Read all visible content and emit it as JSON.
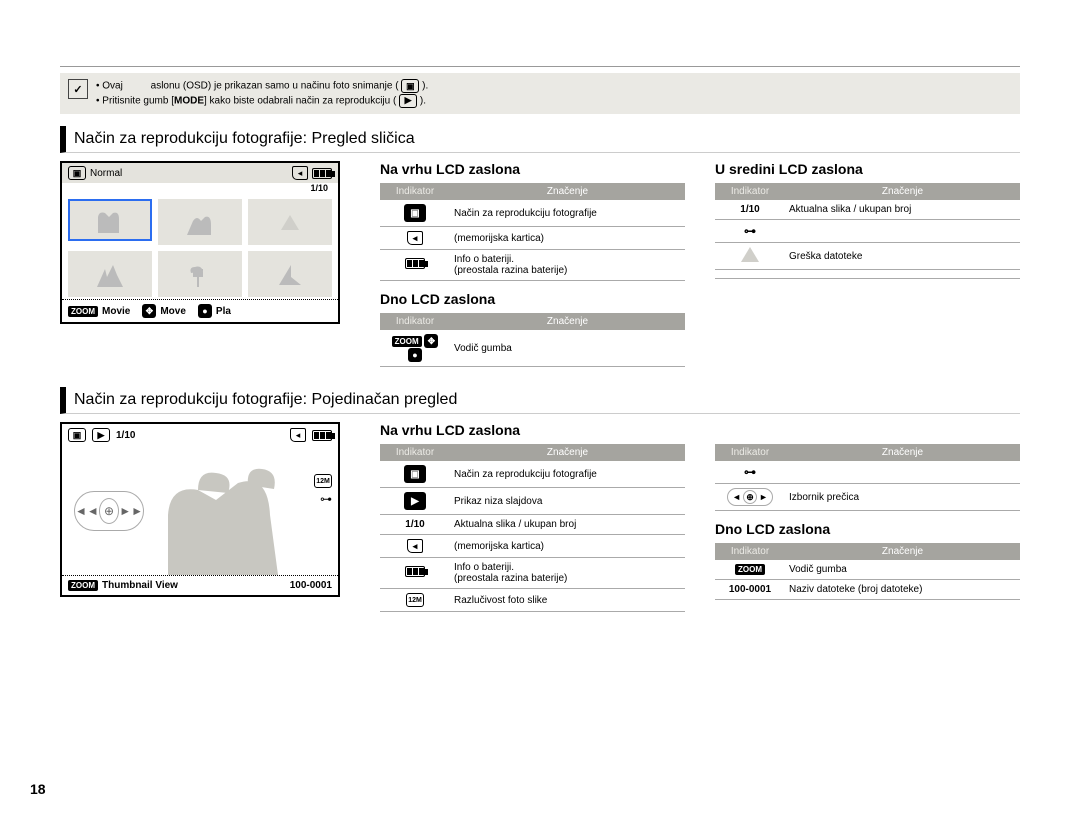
{
  "page_title": "",
  "page_number": "18",
  "note": {
    "icon": "✓",
    "line1_a": "Ovaj",
    "line1_b": "aslonu (OSD) je prikazan samo u načinu foto snimanje (",
    "line1_c": ").",
    "line2_a": "Pritisnite gumb [",
    "line2_mode": "MODE",
    "line2_b": "] kako biste odabrali način za reprodukciju (",
    "line2_c": ")."
  },
  "sections": {
    "thumb": {
      "heading": "Način za reprodukciju fotografije: Pregled sličica",
      "lcd": {
        "normal_label": "Normal",
        "count": "1/10",
        "footer": {
          "zoom": "ZOOM",
          "movie": "Movie",
          "move": "Move",
          "play": "Pla"
        }
      },
      "top": {
        "title": "Na vrhu LCD zaslona",
        "th_indicator": "Indikator",
        "th_meaning": "Značenje",
        "rows": [
          {
            "ind_kind": "play-photo",
            "text": "Način za reprodukciju fotografije"
          },
          {
            "ind_kind": "card",
            "text": "(memorijska kartica)"
          },
          {
            "ind_kind": "battery",
            "text": "Info o bateriji.\n(preostala razina baterije)"
          }
        ]
      },
      "bottom": {
        "title": "Dno LCD zaslona",
        "th_indicator": "Indikator",
        "th_meaning": "Značenje",
        "rows": [
          {
            "ind_kind": "zoom-guide",
            "text": "Vodič gumba"
          }
        ]
      },
      "middle": {
        "title": "U sredini LCD zaslona",
        "th_indicator": "Indikator",
        "th_meaning": "Značenje",
        "rows": [
          {
            "ind_text": "1/10",
            "text": "Aktualna slika / ukupan broj"
          },
          {
            "ind_kind": "key",
            "text": ""
          },
          {
            "ind_kind": "warning",
            "text": "Greška datoteke"
          },
          {
            "ind_text": "",
            "text": ""
          }
        ]
      }
    },
    "single": {
      "heading": "Način za reprodukciju fotografije: Pojedinačan pregled",
      "lcd": {
        "count": "1/10",
        "thumb_label": "Thumbnail View",
        "file_no": "100-0001",
        "zoom": "ZOOM"
      },
      "top_left": {
        "title": "Na vrhu LCD zaslona",
        "th_indicator": "Indikator",
        "th_meaning": "Značenje",
        "rows": [
          {
            "ind_kind": "play-photo",
            "text": "Način za reprodukciju fotografije"
          },
          {
            "ind_kind": "slideshow",
            "text": "Prikaz niza slajdova"
          },
          {
            "ind_text": "1/10",
            "text": "Aktualna slika / ukupan broj"
          },
          {
            "ind_kind": "card",
            "text": "(memorijska kartica)"
          },
          {
            "ind_kind": "battery",
            "text": "Info o bateriji.\n(preostala razina baterije)"
          },
          {
            "ind_kind": "resolution",
            "text": "Razlučivost foto slike"
          }
        ]
      },
      "top_right": {
        "th_indicator": "Indikator",
        "th_meaning": "Značenje",
        "rows": [
          {
            "ind_kind": "key",
            "text": ""
          },
          {
            "ind_kind": "shortcut",
            "text": "Izbornik prečica"
          }
        ]
      },
      "bottom_right": {
        "title": "Dno LCD zaslona",
        "th_indicator": "Indikator",
        "th_meaning": "Značenje",
        "rows": [
          {
            "ind_kind": "zoom",
            "text": "Vodič gumba"
          },
          {
            "ind_text": "100-0001",
            "text": "Naziv datoteke (broj datoteke)"
          }
        ]
      }
    }
  }
}
